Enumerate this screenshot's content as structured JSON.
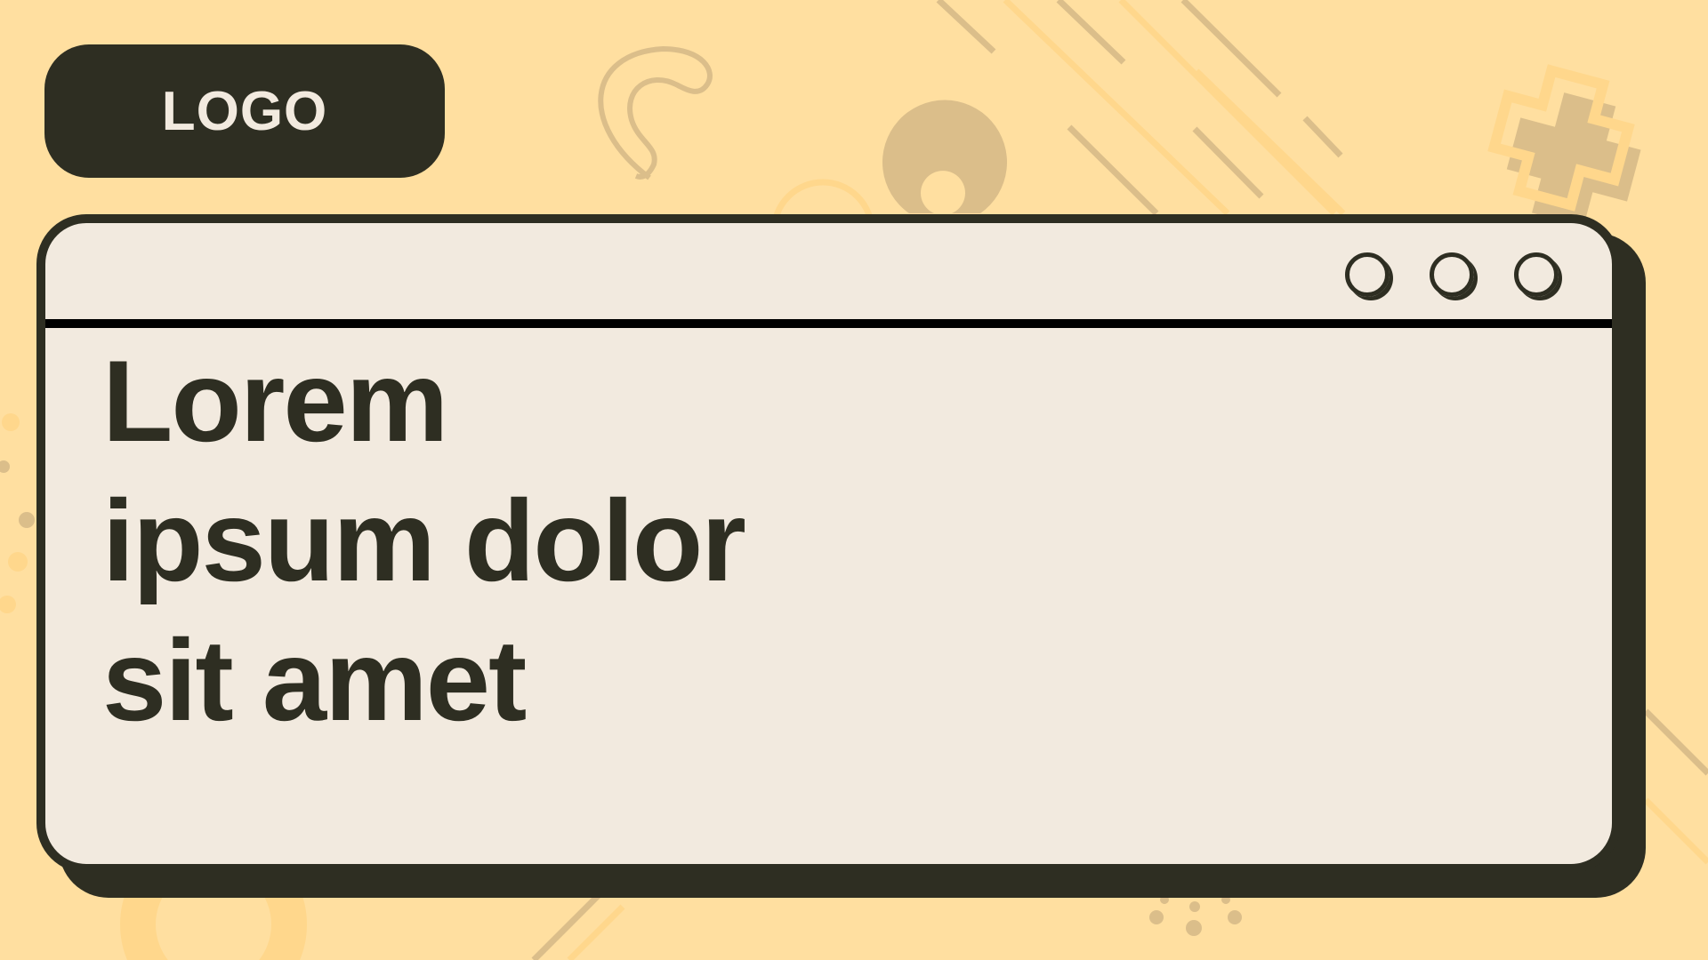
{
  "logo": {
    "text": "LOGO"
  },
  "window": {
    "controls": [
      "circle-button-1",
      "circle-button-2",
      "circle-button-3"
    ],
    "headline_lines": [
      "Lorem",
      "ipsum dolor",
      "sit amet"
    ]
  },
  "colors": {
    "background": "#FFDFA0",
    "panel": "#F2EADF",
    "dark": "#2E2E22",
    "decor_tan": "#DBBE8A",
    "decor_gold": "#FFD78C"
  }
}
